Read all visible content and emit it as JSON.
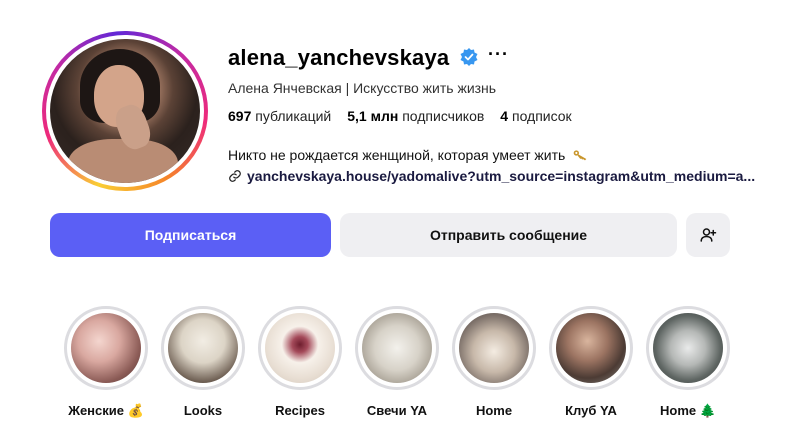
{
  "profile": {
    "username": "alena_yanchevskaya",
    "more": "···",
    "full_name": "Алена Янчевская | Искусство жить жизнь",
    "stats": {
      "posts_count": "697",
      "posts_label": "публикаций",
      "followers_count": "5,1 млн",
      "followers_label": "подписчиков",
      "following_count": "4",
      "following_label": "подписок"
    },
    "bio": "Никто не рождается женщиной, которая умеет жить",
    "link": "yanchevskaya.house/yadomalive?utm_source=instagram&utm_medium=a..."
  },
  "actions": {
    "follow_label": "Подписаться",
    "message_label": "Отправить сообщение",
    "add_user_icon": "add-user-icon"
  },
  "highlights": [
    {
      "label": "Женские 💰"
    },
    {
      "label": "Looks"
    },
    {
      "label": "Recipes"
    },
    {
      "label": "Свечи YA"
    },
    {
      "label": "Home"
    },
    {
      "label": "Клуб YA"
    },
    {
      "label": "Home 🌲"
    }
  ],
  "colors": {
    "accent": "#5b5ff5",
    "secondary_button": "#efeff2",
    "verified": "#3897f0"
  }
}
